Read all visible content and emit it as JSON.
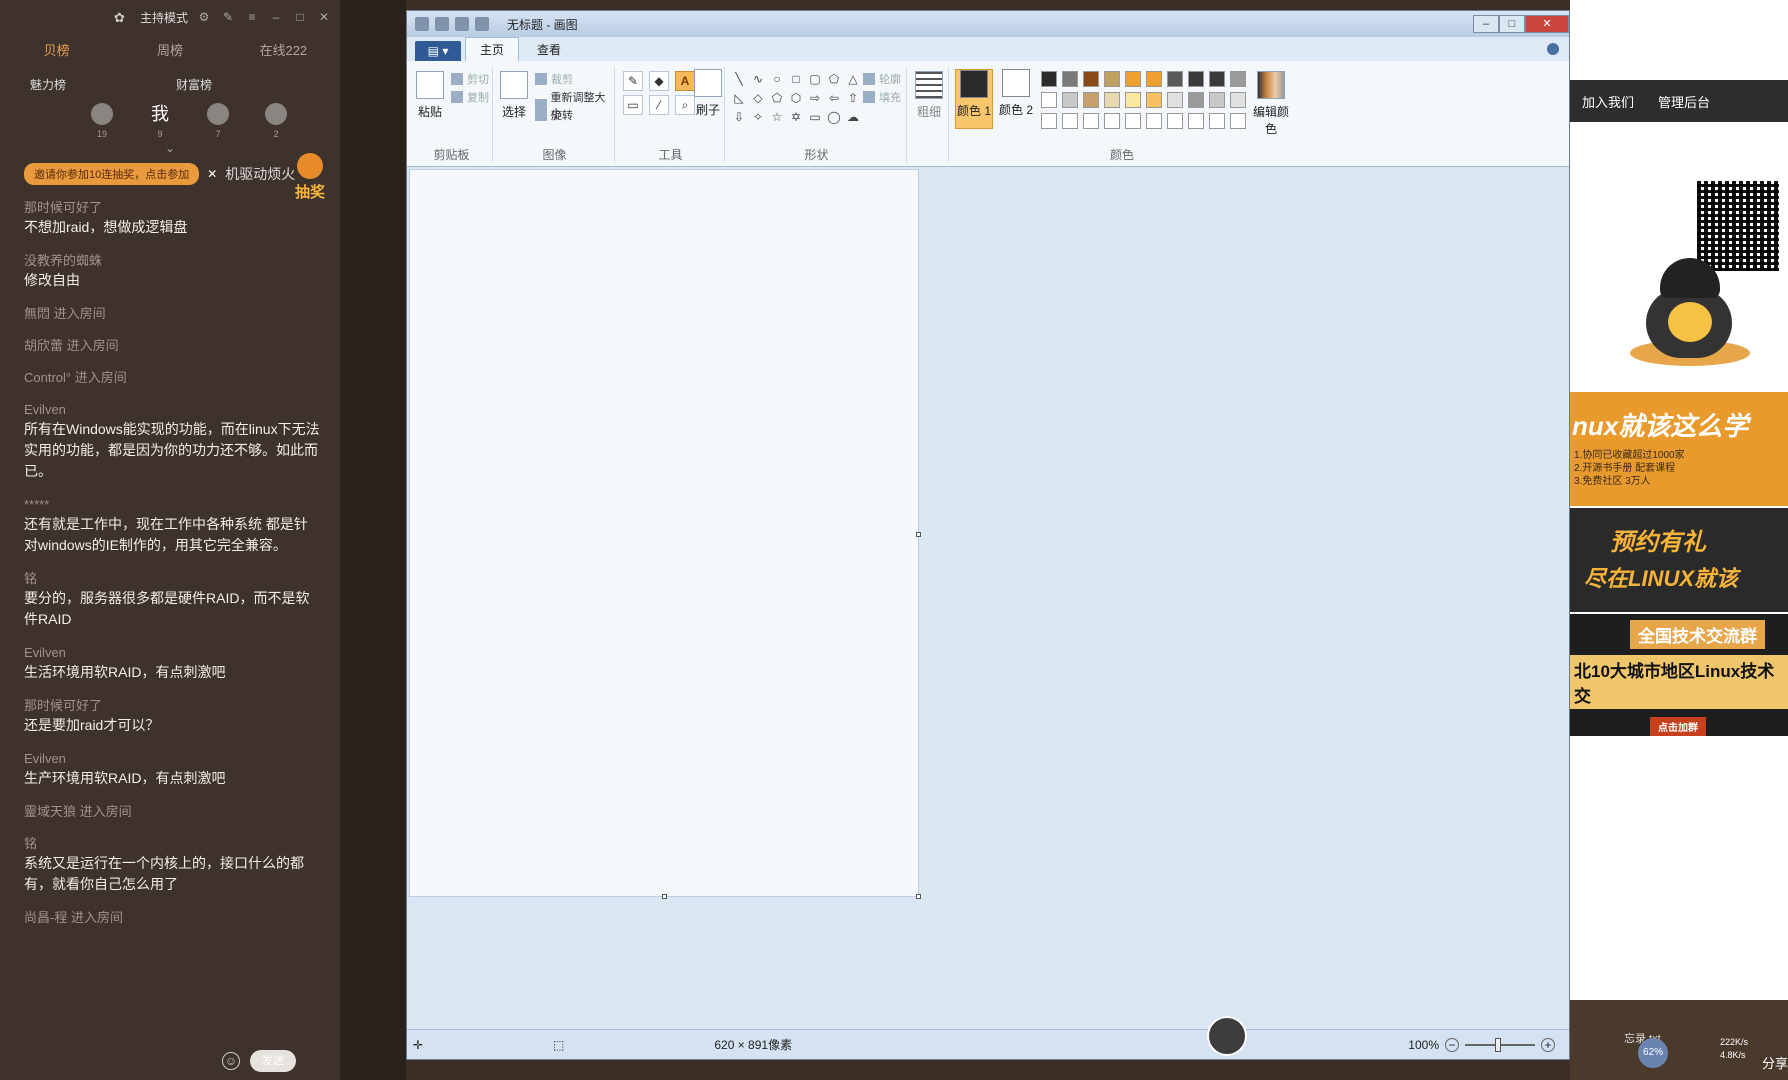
{
  "chat": {
    "mode_label": "主持模式",
    "tabs": [
      "贝榜",
      "周榜",
      "在线222"
    ],
    "rank_titles": [
      "魅力榜",
      "财富榜"
    ],
    "rank_avatars": [
      {
        "label": "",
        "count": "19"
      },
      {
        "label": "我",
        "count": "9"
      },
      {
        "label": "",
        "count": "7"
      },
      {
        "label": "",
        "count": "2"
      }
    ],
    "notice": "邀请你参加10连抽奖，点击参加",
    "notice_tail": "机驱动烦火",
    "lottery": "抽奖",
    "send_label": "发送",
    "messages": [
      {
        "user": "那时候可好了",
        "text": "不想加raid，想做成逻辑盘"
      },
      {
        "user": "没教养的蜘蛛",
        "text": "修改自由"
      },
      {
        "user": "無悶 进入房间",
        "text": ""
      },
      {
        "user": "胡欣蕾 进入房间",
        "text": ""
      },
      {
        "user": "Control° 进入房间",
        "text": ""
      },
      {
        "user": "Evilven",
        "text": "所有在Windows能实现的功能，而在linux下无法实用的功能，都是因为你的功力还不够。如此而已。"
      },
      {
        "user": "*****",
        "text": "还有就是工作中，现在工作中各种系统 都是针对windows的IE制作的，用其它完全兼容。"
      },
      {
        "user": "铭",
        "text": "要分的，服务器很多都是硬件RAID，而不是软件RAID"
      },
      {
        "user": "Evilven",
        "text": "生活环境用软RAID，有点刺激吧"
      },
      {
        "user": "那时候可好了",
        "text": "还是要加raid才可以？"
      },
      {
        "user": "Evilven",
        "text": "生产环境用软RAID，有点刺激吧"
      },
      {
        "user": "靈域天狼 进入房间",
        "text": ""
      },
      {
        "user": "铭",
        "text": "系统又是运行在一个内核上的，接口什么的都有，就看你自己怎么用了"
      },
      {
        "user": "尚昌-程 进入房间",
        "text": ""
      }
    ]
  },
  "paint": {
    "title": "无标题 - 画图",
    "ribbon_tabs": [
      "主页",
      "查看"
    ],
    "groups": {
      "clipboard": {
        "label": "剪贴板",
        "paste": "粘贴",
        "cut": "剪切",
        "copy": "复制"
      },
      "image": {
        "label": "图像",
        "select": "选择",
        "crop": "裁剪",
        "resize": "重新调整大小",
        "rotate": "旋转"
      },
      "tools": {
        "label": "工具",
        "brush": "刷子",
        "tool_a": "A"
      },
      "shapes": {
        "label": "形状",
        "outline": "轮廓",
        "fill": "填充"
      },
      "size": {
        "label": "粗细"
      },
      "colors": {
        "label": "颜色",
        "color1": "颜色 1",
        "color2": "颜色 2",
        "edit": "编辑颜色"
      }
    },
    "color1_hex": "#2b2b2b",
    "color2_hex": "#ffffff",
    "palette": [
      "#2b2b2b",
      "#7a7a7a",
      "#8a4a1a",
      "#c0a060",
      "#f0a030",
      "#f0a030",
      "#5a5a5a",
      "#3a3a3a",
      "#3a3a3a",
      "#9a9a9a",
      "#ffffff",
      "#c8c8c8",
      "#c8a070",
      "#e8d8b0",
      "#f8e8a0",
      "#f8c060",
      "#e0e0e0",
      "#9a9a9a",
      "#c8c8c8",
      "#e0e0e0",
      "#ffffff",
      "#ffffff",
      "#ffffff",
      "#ffffff",
      "#ffffff",
      "#ffffff",
      "#ffffff",
      "#ffffff",
      "#ffffff",
      "#ffffff"
    ],
    "status_dims": "620 × 891像素",
    "zoom": "100%"
  },
  "web": {
    "nav": [
      "加入我们",
      "管理后台"
    ],
    "banner1_big": "nux就该这么学",
    "banner1_small": "1.协同已收藏超过1000家\n2.开源书手册 配套课程\n3.免费社区 3万人",
    "banner2_l1": "预约有礼",
    "banner2_l2": "尽在LINUX就该",
    "banner3_l1": "全国技术交流群",
    "banner3_l2": "北10大城市地区Linux技术交",
    "banner3_btn": "点击加群",
    "tray_file": "忘录.txt",
    "tray_pct": "62%",
    "tray_up": "222K/s",
    "tray_down": "4.8K/s",
    "tray_share": "分享"
  }
}
